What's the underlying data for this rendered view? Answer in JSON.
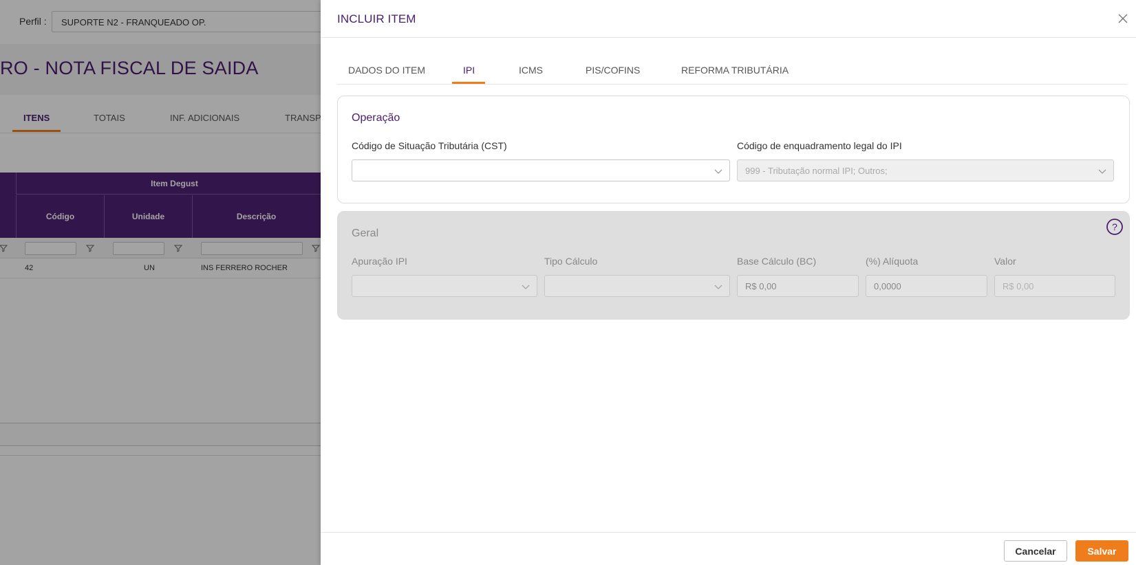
{
  "background": {
    "perfil_label": "Perfil :",
    "perfil_value": "SUPORTE N2 - FRANQUEADO OP.",
    "page_title": "RO - NOTA FISCAL DE SAIDA",
    "tabs": [
      "ITENS",
      "TOTAIS",
      "INF. ADICIONAIS",
      "TRANSP"
    ],
    "grid": {
      "group_title": "Item Degust",
      "columns": [
        "Código",
        "Unidade",
        "Descrição"
      ],
      "row": {
        "codigo": "42",
        "unidade": "UN",
        "descricao": "INS FERRERO ROCHER"
      }
    }
  },
  "drawer": {
    "title": "INCLUIR ITEM",
    "tabs": [
      {
        "label": "DADOS DO ITEM",
        "active": false
      },
      {
        "label": "IPI",
        "active": true
      },
      {
        "label": "ICMS",
        "active": false
      },
      {
        "label": "PIS/COFINS",
        "active": false
      },
      {
        "label": "REFORMA TRIBUTÁRIA",
        "active": false
      }
    ],
    "operacao": {
      "title": "Operação",
      "cst_label": "Código de Situação Tributária (CST)",
      "cst_value": "",
      "enquadramento_label": "Código de enquadramento legal do IPI",
      "enquadramento_value": "999 - Tributação normal IPI; Outros;"
    },
    "geral": {
      "title": "Geral",
      "apuracao_label": "Apuração IPI",
      "apuracao_value": "",
      "tipo_calculo_label": "Tipo Cálculo",
      "tipo_calculo_value": "",
      "base_calculo_label": "Base Cálculo (BC)",
      "base_calculo_value": "R$ 0,00",
      "aliquota_label": "(%) Alíquota",
      "aliquota_value": "0,0000",
      "valor_label": "Valor",
      "valor_value": "R$ 0,00"
    },
    "footer": {
      "cancel_label": "Cancelar",
      "save_label": "Salvar"
    }
  },
  "colors": {
    "primary_purple": "#4b1d6e",
    "accent_orange": "#f07d1b",
    "grid_header": "#4f2174"
  }
}
